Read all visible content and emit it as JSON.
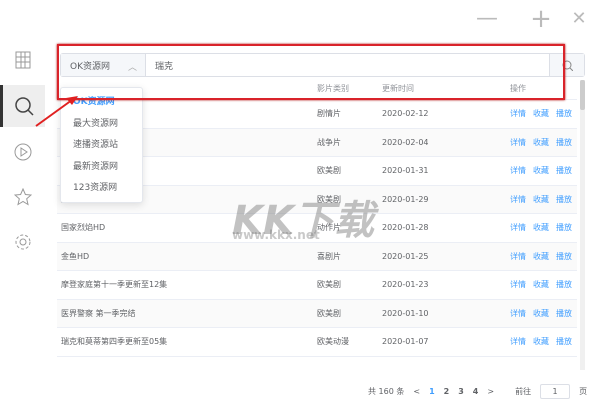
{
  "window": {
    "minimize": "—",
    "maximize": "+",
    "close": "✕"
  },
  "sidebar": {
    "items": [
      {
        "icon": "grid-icon"
      },
      {
        "icon": "search-icon"
      },
      {
        "icon": "play-icon"
      },
      {
        "icon": "star-icon"
      },
      {
        "icon": "gear-icon"
      }
    ]
  },
  "search": {
    "source": "OK资源网",
    "query": "瑞克"
  },
  "dropdown": {
    "options": [
      "OK资源网",
      "最大资源网",
      "速播资源站",
      "最新资源网",
      "123资源网"
    ],
    "selected": 0
  },
  "table": {
    "headers": [
      "影片类别",
      "更新时间",
      "操作"
    ],
    "actions": [
      "详情",
      "收藏",
      "播放"
    ],
    "rows": [
      {
        "title": "",
        "type": "剧情片",
        "date": "2020-02-12"
      },
      {
        "title": "",
        "type": "战争片",
        "date": "2020-02-04"
      },
      {
        "title": "",
        "type": "欧美剧",
        "date": "2020-01-31"
      },
      {
        "title": "集",
        "type": "欧美剧",
        "date": "2020-01-29"
      },
      {
        "title": "国家烈焰HD",
        "type": "动作片",
        "date": "2020-01-28"
      },
      {
        "title": "金鱼HD",
        "type": "喜剧片",
        "date": "2020-01-25"
      },
      {
        "title": "摩登家庭第十一季更新至12集",
        "type": "欧美剧",
        "date": "2020-01-23"
      },
      {
        "title": "医界警察 第一季完结",
        "type": "欧美剧",
        "date": "2020-01-10"
      },
      {
        "title": "瑞克和莫蒂第四季更新至05集",
        "type": "欧美动漫",
        "date": "2020-01-07"
      }
    ]
  },
  "pagination": {
    "total": "共 160 条",
    "prev": "<",
    "pages": [
      "1",
      "2",
      "3",
      "4"
    ],
    "current": "1",
    "next": ">",
    "goto_label": "前往",
    "goto_value": "1",
    "page_suffix": "页"
  },
  "watermark": {
    "text": "KK下载",
    "url": "www.kkx.net"
  }
}
